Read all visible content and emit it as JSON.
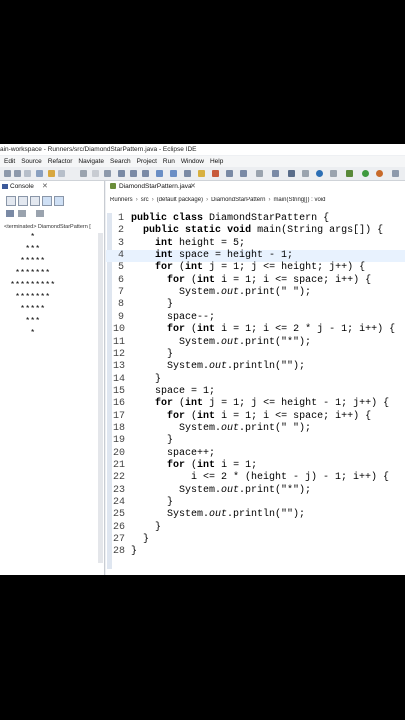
{
  "window": {
    "title": "ain-workspace - Runners/src/DiamondStarPattern.java - Eclipse IDE"
  },
  "menu": [
    "Edit",
    "Source",
    "Refactor",
    "Navigate",
    "Search",
    "Project",
    "Run",
    "Window",
    "Help"
  ],
  "console": {
    "tab_label": "Console",
    "close_glyph": "✕",
    "terminated_label": "<terminated> DiamondStarPattern [",
    "output": "    *\n   ***\n  *****\n *******\n*********\n *******\n  *****\n   ***\n    *"
  },
  "editor": {
    "tab_label": "DiamondStarPattern.java",
    "close_glyph": "✕",
    "breadcrumb": [
      "Runners",
      "src",
      "(default package)",
      "DiamondStarPattern",
      "main(String[]) : void"
    ],
    "lines": [
      {
        "n": "1",
        "code": "public class DiamondStarPattern {"
      },
      {
        "n": "2",
        "code": "  public static void main(String args[]) {"
      },
      {
        "n": "3",
        "code": "    int height = 5;"
      },
      {
        "n": "4",
        "code": "    int space = height - 1;"
      },
      {
        "n": "5",
        "code": "    for (int j = 1; j <= height; j++) {"
      },
      {
        "n": "6",
        "code": "      for (int i = 1; i <= space; i++) {"
      },
      {
        "n": "7",
        "code": "        System.out.print(\" \");"
      },
      {
        "n": "8",
        "code": "      }"
      },
      {
        "n": "9",
        "code": "      space--;"
      },
      {
        "n": "10",
        "code": "      for (int i = 1; i <= 2 * j - 1; i++) {"
      },
      {
        "n": "11",
        "code": "        System.out.print(\"*\");"
      },
      {
        "n": "12",
        "code": "      }"
      },
      {
        "n": "13",
        "code": "      System.out.println(\"\");"
      },
      {
        "n": "14",
        "code": "    }"
      },
      {
        "n": "15",
        "code": "    space = 1;"
      },
      {
        "n": "16",
        "code": "    for (int j = 1; j <= height - 1; j++) {"
      },
      {
        "n": "17",
        "code": "      for (int i = 1; i <= space; i++) {"
      },
      {
        "n": "18",
        "code": "        System.out.print(\" \");"
      },
      {
        "n": "19",
        "code": "      }"
      },
      {
        "n": "20",
        "code": "      space++;"
      },
      {
        "n": "21",
        "code": "      for (int i = 1;"
      },
      {
        "n": "22",
        "code": "          i <= 2 * (height - j) - 1; i++) {"
      },
      {
        "n": "23",
        "code": "        System.out.print(\"*\");"
      },
      {
        "n": "24",
        "code": "      }"
      },
      {
        "n": "25",
        "code": "      System.out.println(\"\");"
      },
      {
        "n": "26",
        "code": "    }"
      },
      {
        "n": "27",
        "code": "  }"
      },
      {
        "n": "28",
        "code": "}"
      }
    ],
    "highlighted_line": "4"
  },
  "colors": {
    "editor_bg": "#ffffff",
    "current_line": "#e8f2fe",
    "ide_chrome": "#eef0f3",
    "letterbox": "#000000"
  }
}
